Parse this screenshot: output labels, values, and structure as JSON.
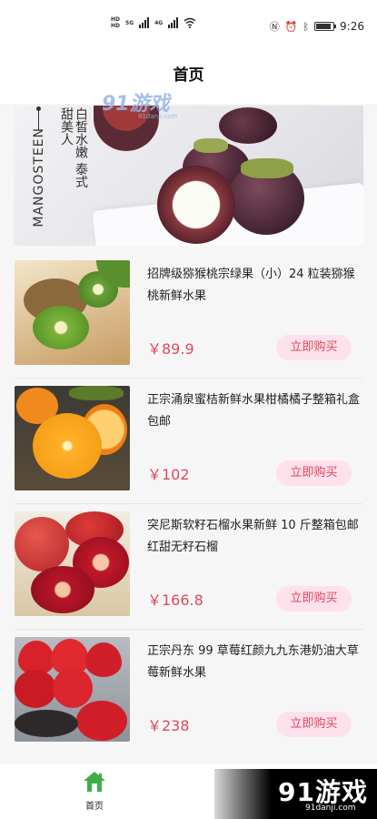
{
  "status_bar": {
    "time": "9:26",
    "hd_top": "HD",
    "hd_bottom": "HD",
    "signal_1": "5G",
    "signal_2": "4G"
  },
  "header": {
    "title": "首页"
  },
  "banner": {
    "cn_text": "白皙水嫩 泰式甜美人",
    "en_text": "MANGOSTEEN",
    "watermark": "91游戏",
    "watermark_url": "91danji.com"
  },
  "products": [
    {
      "title": "招牌级猕猴桃宗绿果（小）24 粒装猕猴桃新鲜水果",
      "price": "￥89.9",
      "button": "立即购买",
      "image_icon": "kiwi-image"
    },
    {
      "title": "正宗涌泉蜜桔新鲜水果柑橘橘子整箱礼盒包邮",
      "price": "￥102",
      "button": "立即购买",
      "image_icon": "orange-image"
    },
    {
      "title": "突尼斯软籽石榴水果新鲜 10 斤整箱包邮红甜无籽石榴",
      "price": "￥166.8",
      "button": "立即购买",
      "image_icon": "pomegranate-image"
    },
    {
      "title": "正宗丹东 99 草莓红颜九九东港奶油大草莓新鲜水果",
      "price": "￥238",
      "button": "立即购买",
      "image_icon": "strawberry-image"
    }
  ],
  "tab_bar": {
    "items": [
      {
        "label": "首页",
        "icon": "home-icon",
        "active": true
      }
    ],
    "active_color": "#3fae49"
  },
  "watermark_bottom": {
    "main": "91游戏",
    "sub": "91danji.com"
  },
  "colors": {
    "price": "#e0485e",
    "button_bg": "#fde1ec"
  }
}
